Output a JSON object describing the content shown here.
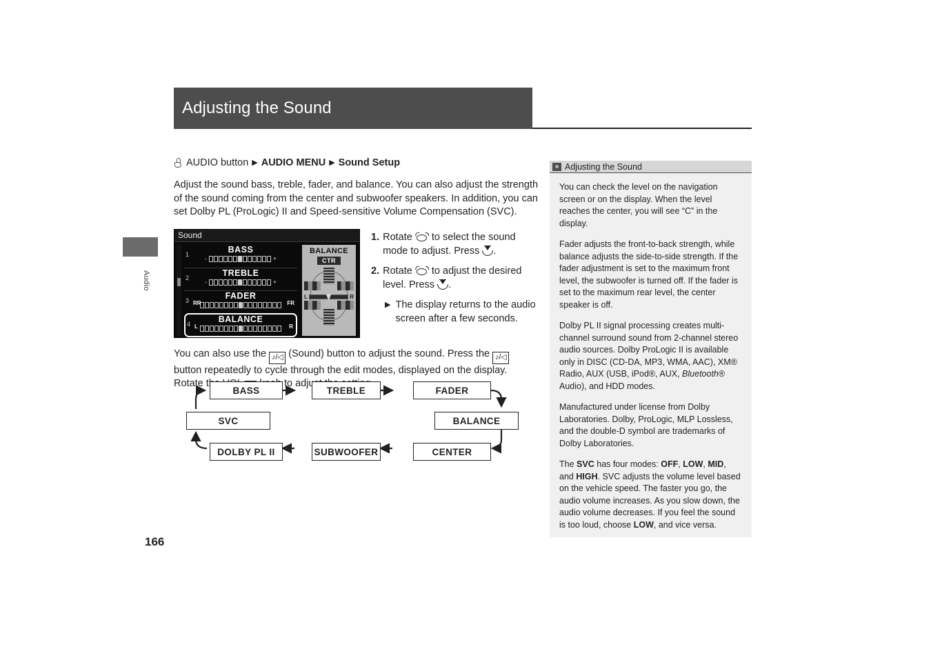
{
  "header": {
    "title": "Adjusting the Sound"
  },
  "side_tab": {
    "label": "Audio"
  },
  "page_number": "166",
  "breadcrumb": {
    "button_icon": "finger-press-icon",
    "button_text": "AUDIO button",
    "arrow": "▶",
    "menu": "AUDIO MENU",
    "target": "Sound Setup"
  },
  "intro": "Adjust the sound bass, treble, fader, and balance. You can also adjust the strength of the sound coming from the center and subwoofer speakers. In addition, you can set Dolby PL (ProLogic) II and Speed-sensitive Volume Compensation (SVC).",
  "display": {
    "title": "Sound",
    "meters": [
      {
        "index": "1",
        "name": "BASS",
        "left_mark": "-",
        "right_mark": "+",
        "left_label": "",
        "right_label": "",
        "segments": 13,
        "value_index": 6,
        "selected": false
      },
      {
        "index": "2",
        "name": "TREBLE",
        "left_mark": "-",
        "right_mark": "+",
        "left_label": "",
        "right_label": "",
        "segments": 13,
        "value_index": 6,
        "selected": false
      },
      {
        "index": "3",
        "name": "FADER",
        "left_mark": "",
        "right_mark": "",
        "left_label": "RR",
        "right_label": "FR",
        "segments": 17,
        "value_index": 8,
        "selected": false
      },
      {
        "index": "4",
        "name": "BALANCE",
        "left_mark": "",
        "right_mark": "",
        "left_label": "L",
        "right_label": "R",
        "segments": 17,
        "value_index": 8,
        "selected": true
      }
    ],
    "balance_panel": {
      "title": "BALANCE",
      "badge": "CTR",
      "left_label": "L",
      "right_label": "R"
    }
  },
  "steps": [
    {
      "num": "1.",
      "part_a": "Rotate",
      "knob_icon": "rotary-knob-icon",
      "part_b": "to select the sound mode to adjust. Press",
      "press_icon": "press-knob-icon",
      "part_c": "."
    },
    {
      "num": "2.",
      "part_a": "Rotate",
      "knob_icon": "rotary-knob-icon",
      "part_b": "to adjust the desired level. Press",
      "press_icon": "press-knob-icon",
      "part_c": "."
    }
  ],
  "substep": {
    "arrow": "▶",
    "text": "The display returns to the audio screen after a few seconds."
  },
  "note_paragraph": {
    "part_a": "You can also use the",
    "sound_icon_label": "♪/◁",
    "part_b": "(Sound) button to adjust the sound. Press the",
    "part_c": "button repeatedly to cycle through the edit modes, displayed on the display. Rotate the VOL",
    "power_icon_label": "⏻",
    "part_d": "knob to adjust the setting."
  },
  "flow_diagram": {
    "nodes": [
      {
        "id": "bass",
        "label": "BASS"
      },
      {
        "id": "treble",
        "label": "TREBLE"
      },
      {
        "id": "fader",
        "label": "FADER"
      },
      {
        "id": "balance",
        "label": "BALANCE"
      },
      {
        "id": "center",
        "label": "CENTER"
      },
      {
        "id": "subwoofer",
        "label": "SUBWOOFER"
      },
      {
        "id": "dolby",
        "label": "DOLBY PL II"
      },
      {
        "id": "svc",
        "label": "SVC"
      }
    ],
    "edges": [
      "bass->treble",
      "treble->fader",
      "fader->balance",
      "balance->center",
      "center->subwoofer",
      "subwoofer->dolby",
      "dolby->svc",
      "svc->bass"
    ]
  },
  "aside": {
    "icon": "double-chevron-icon",
    "title": "Adjusting the Sound",
    "paragraphs": [
      {
        "html": "You can check the level on the navigation screen or on the display. When the level reaches the center, you will see “C” in the display."
      },
      {
        "html": "Fader adjusts the front-to-back strength, while balance adjusts the side-to-side strength. If the fader adjustment is set to the maximum front level, the subwoofer is turned off. If the fader is set to the maximum rear level, the center speaker is off."
      },
      {
        "html": "Dolby PL II signal processing creates multi-channel surround sound from 2-channel stereo audio sources. Dolby ProLogic II is available only in DISC (CD-DA, MP3, WMA, AAC), XM® Radio, AUX (USB, iPod®, AUX, <i>Bluetooth</i>® Audio), and HDD modes."
      },
      {
        "html": "Manufactured under license from Dolby Laboratories. Dolby, ProLogic, MLP Lossless, and the double-D symbol are trademarks of Dolby Laboratories."
      },
      {
        "html": "The <b>SVC</b> has four modes: <b>OFF</b>, <b>LOW</b>, <b>MID</b>, and <b>HIGH</b>. SVC adjusts the volume level based on the vehicle speed. The faster you go, the audio volume increases. As you slow down, the audio volume decreases. If you feel the sound is too loud, choose <b>LOW</b>, and vice versa."
      }
    ]
  },
  "colors": {
    "header_bg": "#4d4d4d",
    "aside_head_bg": "#d6d6d6",
    "aside_body_bg": "#f0f0f0",
    "tab_bg": "#6b6b6b",
    "text": "#231f20"
  }
}
